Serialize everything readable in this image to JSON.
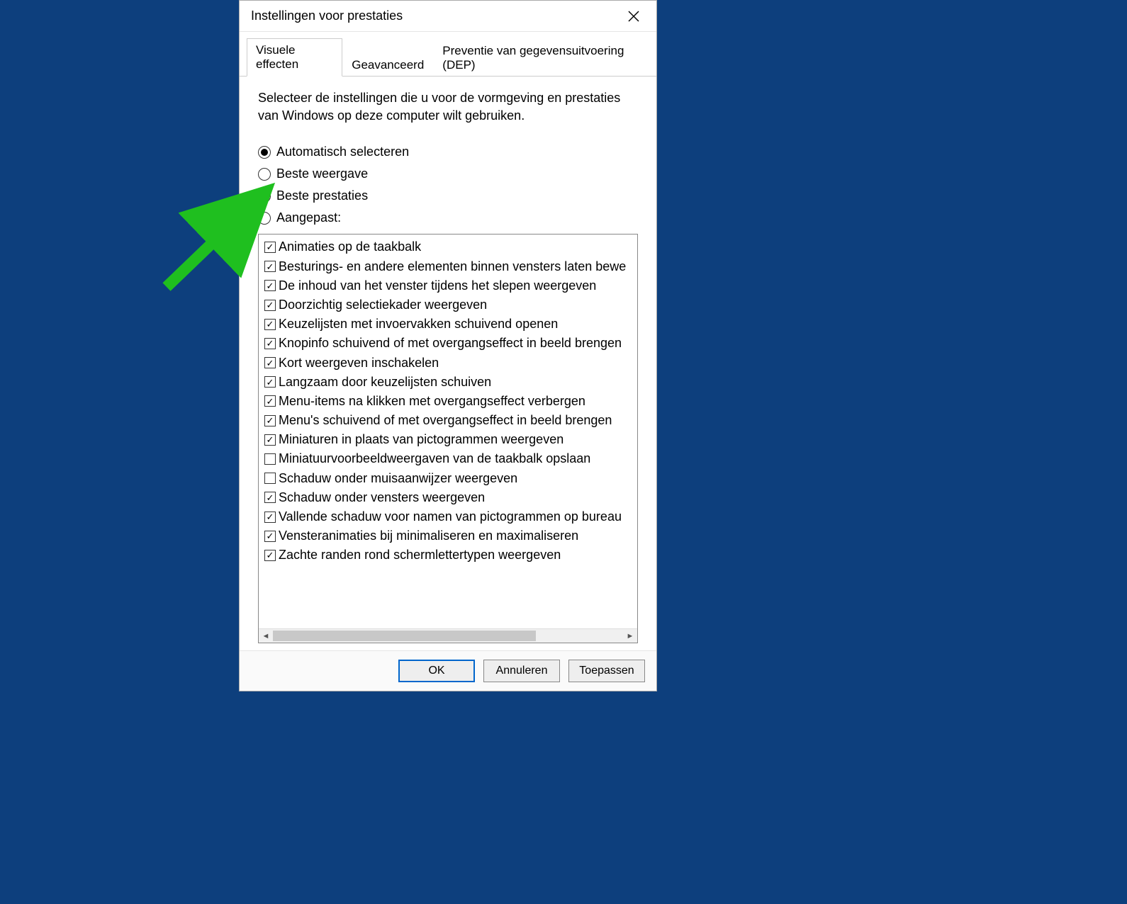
{
  "window": {
    "title": "Instellingen voor prestaties"
  },
  "tabs": [
    {
      "label": "Visuele effecten",
      "active": true
    },
    {
      "label": "Geavanceerd",
      "active": false
    },
    {
      "label": "Preventie van gegevensuitvoering (DEP)",
      "active": false
    }
  ],
  "description": "Selecteer de instellingen die u voor de vormgeving en prestaties van Windows op deze computer wilt gebruiken.",
  "radios": [
    {
      "label": "Automatisch selecteren",
      "selected": true
    },
    {
      "label": "Beste weergave",
      "selected": false
    },
    {
      "label": "Beste prestaties",
      "selected": false
    },
    {
      "label": "Aangepast:",
      "selected": false
    }
  ],
  "checkboxes": [
    {
      "label": "Animaties op de taakbalk",
      "checked": true
    },
    {
      "label": "Besturings- en andere elementen binnen vensters laten bewe",
      "checked": true
    },
    {
      "label": "De inhoud van het venster tijdens het slepen weergeven",
      "checked": true
    },
    {
      "label": "Doorzichtig selectiekader weergeven",
      "checked": true
    },
    {
      "label": "Keuzelijsten met invoervakken schuivend openen",
      "checked": true
    },
    {
      "label": "Knopinfo schuivend of met overgangseffect in beeld brengen",
      "checked": true
    },
    {
      "label": "Kort weergeven inschakelen",
      "checked": true
    },
    {
      "label": "Langzaam door keuzelijsten schuiven",
      "checked": true
    },
    {
      "label": "Menu-items na klikken met overgangseffect verbergen",
      "checked": true
    },
    {
      "label": "Menu's schuivend of met overgangseffect in beeld brengen",
      "checked": true
    },
    {
      "label": "Miniaturen in plaats van pictogrammen weergeven",
      "checked": true
    },
    {
      "label": "Miniatuurvoorbeeldweergaven van de taakbalk opslaan",
      "checked": false
    },
    {
      "label": "Schaduw onder muisaanwijzer weergeven",
      "checked": false
    },
    {
      "label": "Schaduw onder vensters weergeven",
      "checked": true
    },
    {
      "label": "Vallende schaduw voor namen van pictogrammen op bureau",
      "checked": true
    },
    {
      "label": "Vensteranimaties bij minimaliseren en maximaliseren",
      "checked": true
    },
    {
      "label": "Zachte randen rond schermlettertypen weergeven",
      "checked": true
    }
  ],
  "buttons": {
    "ok": "OK",
    "cancel": "Annuleren",
    "apply": "Toepassen"
  }
}
